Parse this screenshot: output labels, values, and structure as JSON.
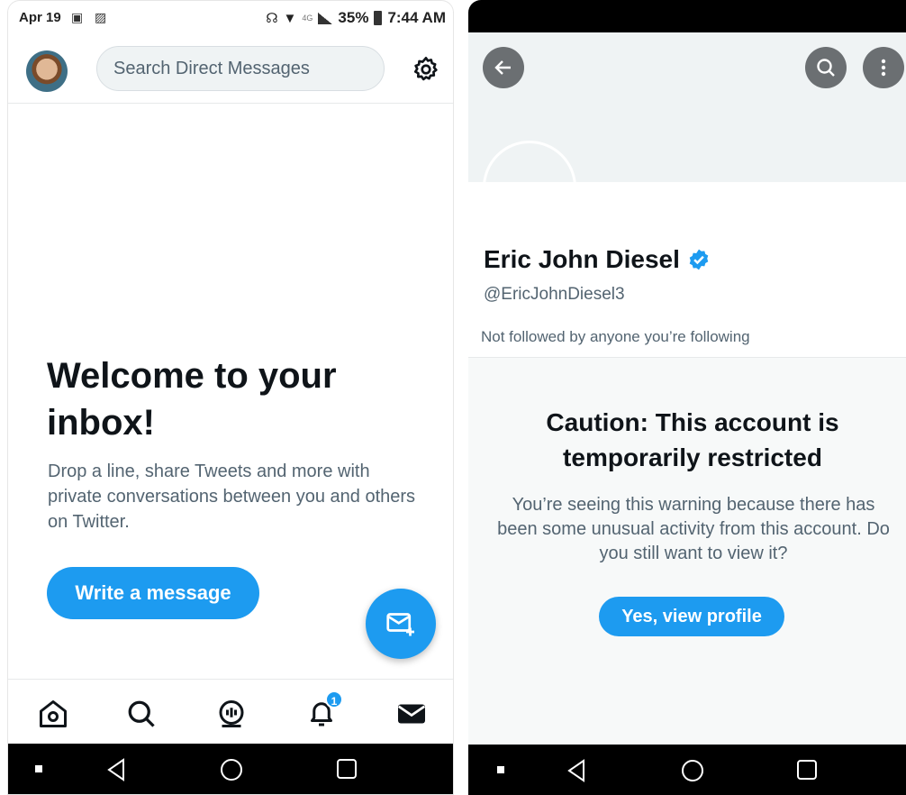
{
  "left": {
    "status_bar": {
      "date": "Apr 19",
      "network": "4G",
      "battery": "35%",
      "time": "7:44 AM"
    },
    "search_placeholder": "Search Direct Messages",
    "welcome": {
      "title": "Welcome to your inbox!",
      "subtitle": "Drop a line, share Tweets and more with private conversations between you and others on Twitter.",
      "button": "Write a message"
    },
    "nav": {
      "notification_count": "1"
    }
  },
  "right": {
    "profile": {
      "name": "Eric John Diesel",
      "handle": "@EricJohnDiesel3",
      "followed_by": "Not followed by anyone you’re following"
    },
    "caution": {
      "title": "Caution: This account is temporarily restricted",
      "text": "You’re seeing this warning because there has been some unusual activity from this account. Do you still want to view it?",
      "button": "Yes, view profile"
    }
  },
  "colors": {
    "accent": "#1d9bf0",
    "text_primary": "#0f1419",
    "text_secondary": "#536471"
  }
}
